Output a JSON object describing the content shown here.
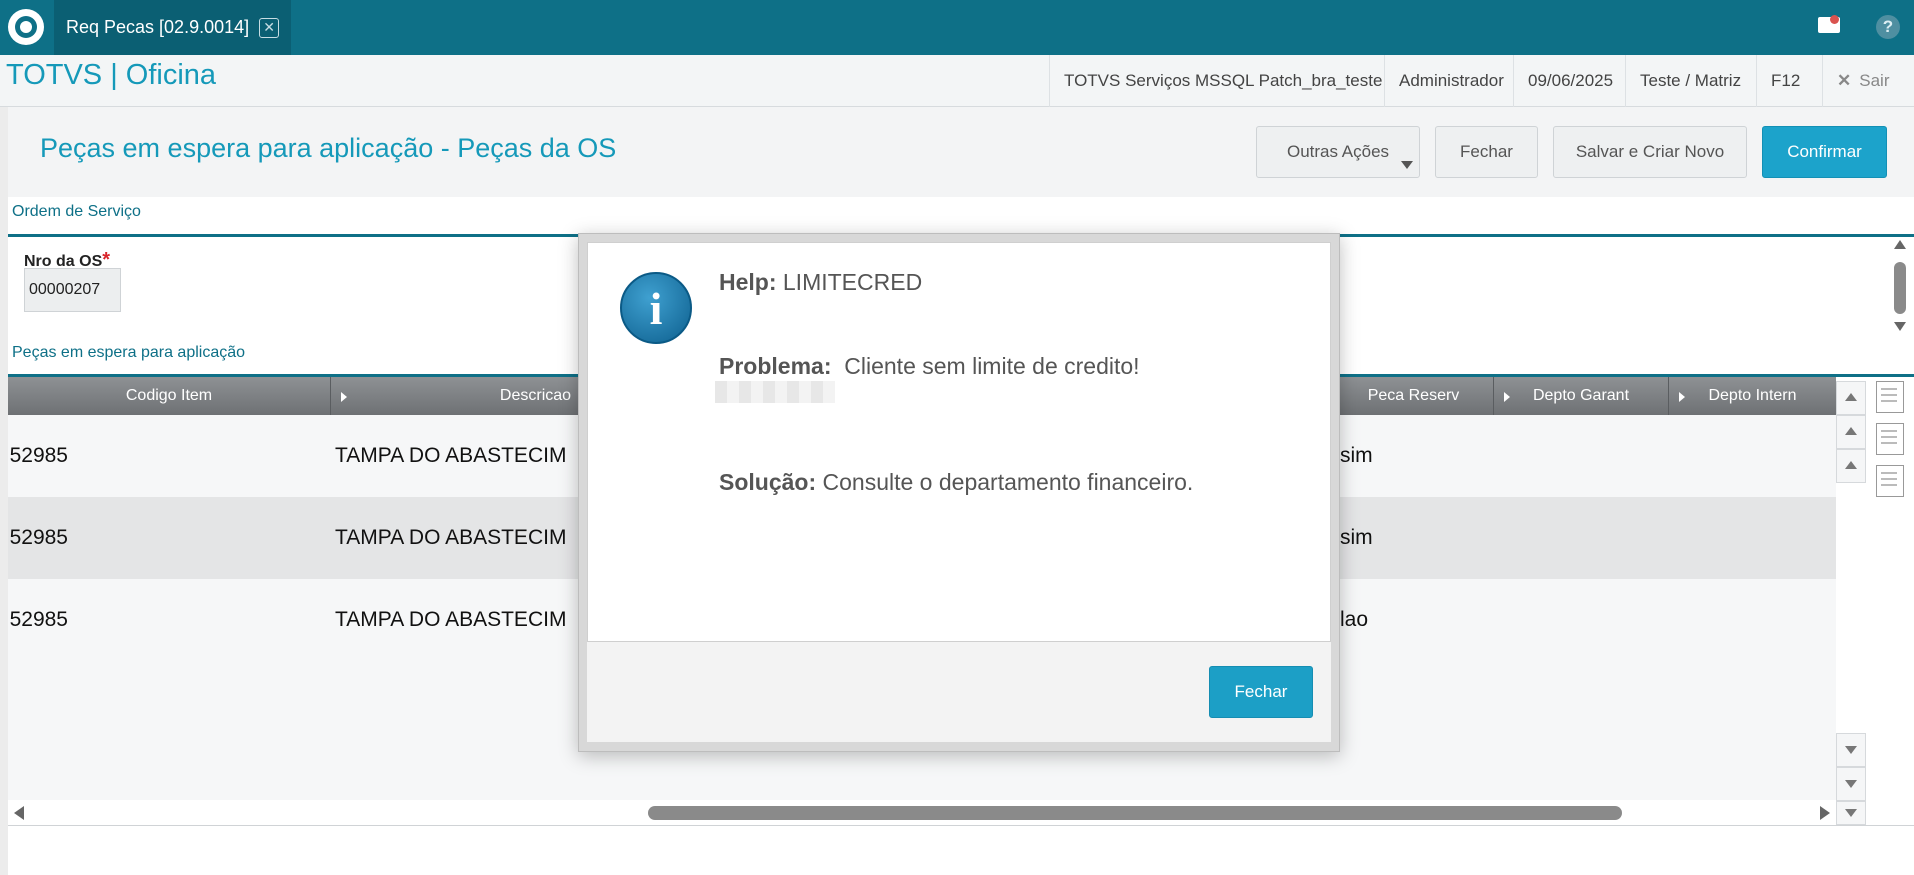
{
  "topbar": {
    "tab_label": "Req Pecas [02.9.0014]",
    "tab_close": "✕",
    "help_glyph": "?"
  },
  "header": {
    "app_title": "TOTVS | Oficina",
    "environment": "TOTVS Serviços MSSQL Patch_bra_teste",
    "user": "Administrador",
    "date": "09/06/2025",
    "company": "Teste / Matriz",
    "shortcut": "F12",
    "exit_label": "Sair",
    "exit_glyph": "✕"
  },
  "page": {
    "title": "Peças em espera para aplicação - Peças da OS",
    "buttons": {
      "outras": "Outras Ações",
      "fechar": "Fechar",
      "salvar_novo": "Salvar e Criar Novo",
      "confirmar": "Confirmar"
    }
  },
  "ordem": {
    "section_label": "Ordem de Serviço",
    "nro_label": "Nro da OS",
    "required_mark": "*",
    "nro_value": "00000207"
  },
  "pecas": {
    "section_label": "Peças em espera para aplicação",
    "columns": [
      "Codigo Item",
      "Descricao",
      "Peca Reserv",
      "Depto Garant",
      "Depto Intern"
    ],
    "rows": [
      {
        "codigo": "52985",
        "descricao": "TAMPA DO ABASTECIM",
        "peca_reserv": "sim"
      },
      {
        "codigo": "52985",
        "descricao": "TAMPA DO ABASTECIM",
        "peca_reserv": "sim"
      },
      {
        "codigo": "52985",
        "descricao": "TAMPA DO ABASTECIM",
        "peca_reserv": "lao"
      }
    ]
  },
  "modal": {
    "icon_glyph": "i",
    "help_label": "Help:",
    "help_value": "LIMITECRED",
    "problema_label": "Problema:",
    "problema_value": "Cliente sem limite de credito!",
    "solucao_label": "Solução:",
    "solucao_value": "Consulte o departamento financeiro.",
    "close_button": "Fechar"
  },
  "colors": {
    "topbar": "#0e7087",
    "accent": "#1599b9",
    "primary_button": "#1ca3cb",
    "required": "#d9252b"
  }
}
